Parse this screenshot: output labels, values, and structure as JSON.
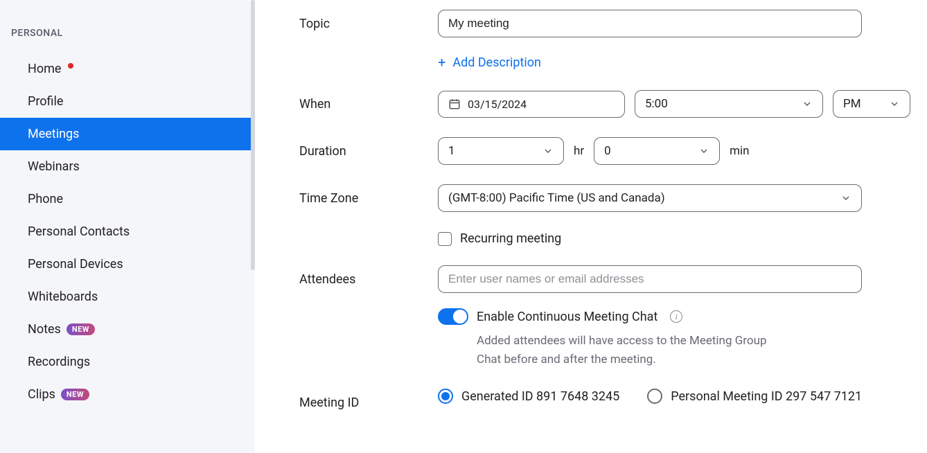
{
  "sidebar": {
    "section": "PERSONAL",
    "items": [
      {
        "label": "Home",
        "dot": true
      },
      {
        "label": "Profile"
      },
      {
        "label": "Meetings",
        "active": true
      },
      {
        "label": "Webinars"
      },
      {
        "label": "Phone"
      },
      {
        "label": "Personal Contacts"
      },
      {
        "label": "Personal Devices"
      },
      {
        "label": "Whiteboards"
      },
      {
        "label": "Notes",
        "badge": "NEW"
      },
      {
        "label": "Recordings"
      },
      {
        "label": "Clips",
        "badge": "NEW"
      }
    ]
  },
  "form": {
    "topic_label": "Topic",
    "topic_value": "My meeting",
    "add_description": "Add Description",
    "when_label": "When",
    "date": "03/15/2024",
    "time": "5:00",
    "ampm": "PM",
    "duration_label": "Duration",
    "duration_hr": "1",
    "hr_unit": "hr",
    "duration_min": "0",
    "min_unit": "min",
    "timezone_label": "Time Zone",
    "timezone_value": "(GMT-8:00) Pacific Time (US and Canada)",
    "recurring_label": "Recurring meeting",
    "attendees_label": "Attendees",
    "attendees_placeholder": "Enter user names or email addresses",
    "continuous_chat_label": "Enable Continuous Meeting Chat",
    "continuous_chat_help": "Added attendees will have access to the Meeting Group Chat before and after the meeting.",
    "meeting_id_label": "Meeting ID",
    "generated_id_label": "Generated ID 891 7648 3245",
    "personal_id_label": "Personal Meeting ID 297 547 7121"
  }
}
